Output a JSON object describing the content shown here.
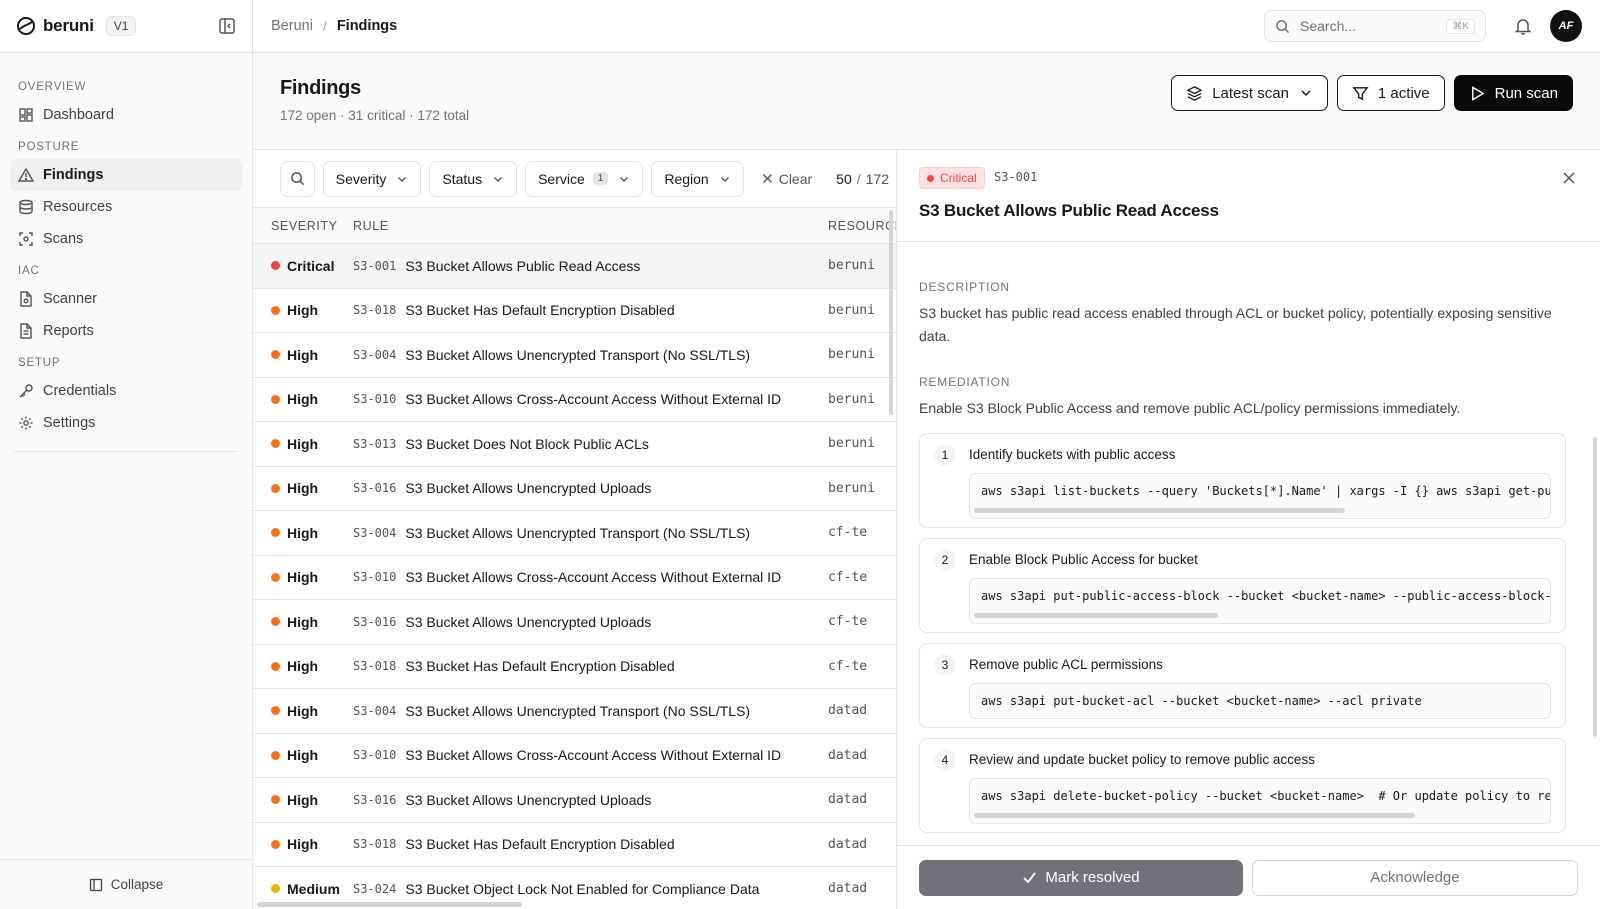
{
  "brand": {
    "name": "beruni",
    "version": "V1"
  },
  "sidebar": {
    "sections": [
      {
        "label": "OVERVIEW",
        "items": [
          {
            "label": "Dashboard",
            "icon": "grid-icon"
          }
        ]
      },
      {
        "label": "POSTURE",
        "items": [
          {
            "label": "Findings",
            "icon": "alert-triangle-icon",
            "active": true
          },
          {
            "label": "Resources",
            "icon": "database-icon"
          },
          {
            "label": "Scans",
            "icon": "scan-icon"
          }
        ]
      },
      {
        "label": "IAC",
        "items": [
          {
            "label": "Scanner",
            "icon": "file-scan-icon"
          },
          {
            "label": "Reports",
            "icon": "file-text-icon"
          }
        ]
      },
      {
        "label": "SETUP",
        "items": [
          {
            "label": "Credentials",
            "icon": "key-icon"
          },
          {
            "label": "Settings",
            "icon": "gear-icon"
          }
        ]
      }
    ],
    "collapse_label": "Collapse"
  },
  "topbar": {
    "breadcrumb": [
      "Beruni",
      "Findings"
    ],
    "search_placeholder": "Search...",
    "search_shortcut": "⌘K",
    "avatar_initials": "AF"
  },
  "page": {
    "title": "Findings",
    "subtitle": "172 open · 31 critical · 172 total",
    "actions": {
      "scan_select": "Latest scan",
      "filters": "1 active",
      "run": "Run scan"
    }
  },
  "filters": {
    "severity": "Severity",
    "status": "Status",
    "service": "Service",
    "service_count": "1",
    "region": "Region",
    "clear": "Clear",
    "shown": "50",
    "total": "172"
  },
  "table": {
    "headers": {
      "severity": "SEVERITY",
      "rule": "RULE",
      "resource": "RESOURCE"
    },
    "rows": [
      {
        "severity": "Critical",
        "id": "S3-001",
        "rule": "S3 Bucket Allows Public Read Access",
        "resource": "beruni"
      },
      {
        "severity": "High",
        "id": "S3-018",
        "rule": "S3 Bucket Has Default Encryption Disabled",
        "resource": "beruni"
      },
      {
        "severity": "High",
        "id": "S3-004",
        "rule": "S3 Bucket Allows Unencrypted Transport (No SSL/TLS)",
        "resource": "beruni"
      },
      {
        "severity": "High",
        "id": "S3-010",
        "rule": "S3 Bucket Allows Cross-Account Access Without External ID",
        "resource": "beruni"
      },
      {
        "severity": "High",
        "id": "S3-013",
        "rule": "S3 Bucket Does Not Block Public ACLs",
        "resource": "beruni"
      },
      {
        "severity": "High",
        "id": "S3-016",
        "rule": "S3 Bucket Allows Unencrypted Uploads",
        "resource": "beruni"
      },
      {
        "severity": "High",
        "id": "S3-004",
        "rule": "S3 Bucket Allows Unencrypted Transport (No SSL/TLS)",
        "resource": "cf-te"
      },
      {
        "severity": "High",
        "id": "S3-010",
        "rule": "S3 Bucket Allows Cross-Account Access Without External ID",
        "resource": "cf-te"
      },
      {
        "severity": "High",
        "id": "S3-016",
        "rule": "S3 Bucket Allows Unencrypted Uploads",
        "resource": "cf-te"
      },
      {
        "severity": "High",
        "id": "S3-018",
        "rule": "S3 Bucket Has Default Encryption Disabled",
        "resource": "cf-te"
      },
      {
        "severity": "High",
        "id": "S3-004",
        "rule": "S3 Bucket Allows Unencrypted Transport (No SSL/TLS)",
        "resource": "datad"
      },
      {
        "severity": "High",
        "id": "S3-010",
        "rule": "S3 Bucket Allows Cross-Account Access Without External ID",
        "resource": "datad"
      },
      {
        "severity": "High",
        "id": "S3-016",
        "rule": "S3 Bucket Allows Unencrypted Uploads",
        "resource": "datad"
      },
      {
        "severity": "High",
        "id": "S3-018",
        "rule": "S3 Bucket Has Default Encryption Disabled",
        "resource": "datad"
      },
      {
        "severity": "Medium",
        "id": "S3-024",
        "rule": "S3 Bucket Object Lock Not Enabled for Compliance Data",
        "resource": "datad"
      }
    ]
  },
  "severity_colors": {
    "Critical": "#ef4444",
    "High": "#f97316",
    "Medium": "#eab308"
  },
  "detail": {
    "severity": "Critical",
    "code": "S3-001",
    "title": "S3 Bucket Allows Public Read Access",
    "description_label": "DESCRIPTION",
    "description": "S3 bucket has public read access enabled through ACL or bucket policy, potentially exposing sensitive data.",
    "remediation_label": "REMEDIATION",
    "remediation": "Enable S3 Block Public Access and remove public ACL/policy permissions immediately.",
    "steps": [
      {
        "n": "1",
        "title": "Identify buckets with public access",
        "code": "aws s3api list-buckets --query 'Buckets[*].Name' | xargs -I {} aws s3api get-pu"
      },
      {
        "n": "2",
        "title": "Enable Block Public Access for bucket",
        "code": "aws s3api put-public-access-block --bucket <bucket-name> --public-access-block-"
      },
      {
        "n": "3",
        "title": "Remove public ACL permissions",
        "code": "aws s3api put-bucket-acl --bucket <bucket-name> --acl private"
      },
      {
        "n": "4",
        "title": "Review and update bucket policy to remove public access",
        "code": "aws s3api delete-bucket-policy --bucket <bucket-name>  # Or update policy to re"
      }
    ],
    "resolve_label": "Mark resolved",
    "ack_label": "Acknowledge"
  }
}
